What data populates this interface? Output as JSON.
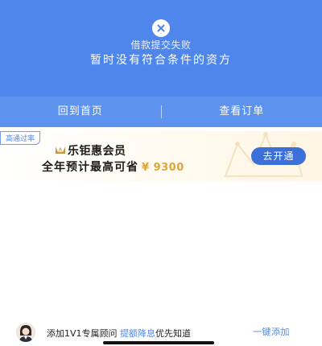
{
  "hero": {
    "title": "借款提交失败",
    "message": "暂时没有符合条件的资方",
    "background": "#4f86ec"
  },
  "actions": {
    "home_label": "回到首页",
    "orders_label": "查看订单"
  },
  "promo": {
    "badge": "高通过率",
    "title": "乐钜惠会员",
    "subtitle": "全年预计最高可省",
    "amount": "¥ 9300",
    "button_label": "去开通",
    "amount_color": "#e3a437"
  },
  "footer": {
    "text_before": "添加1V1专属顾问",
    "highlight": "提额降息",
    "text_after": "优先知道",
    "add_label": "一键添加"
  },
  "icons": {
    "fail": "close-icon",
    "crown": "crown-icon",
    "advisor": "avatar"
  }
}
